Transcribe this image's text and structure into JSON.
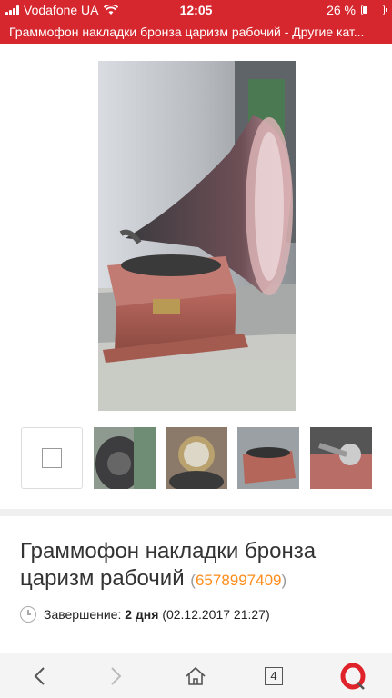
{
  "status": {
    "carrier": "Vodafone UA",
    "time": "12:05",
    "battery": "26 %",
    "battery_level": 0.26
  },
  "page_title": "Граммофон накладки бронза царизм рабочий - Другие кат...",
  "gallery": {
    "thumbnails": [
      {
        "name": "placeholder"
      },
      {
        "name": "horn-mouth"
      },
      {
        "name": "soundbox"
      },
      {
        "name": "gramophone-box"
      },
      {
        "name": "tonearm"
      }
    ]
  },
  "lot": {
    "title": "Граммофон накладки бронза царизм рабочий",
    "id_open": "(",
    "id": "6578997409",
    "id_close": ")",
    "ending_label": "Завершение:",
    "ending_value": "2 дня",
    "ending_date": "(02.12.2017 21:27)"
  },
  "browser": {
    "tab_count": "4"
  }
}
